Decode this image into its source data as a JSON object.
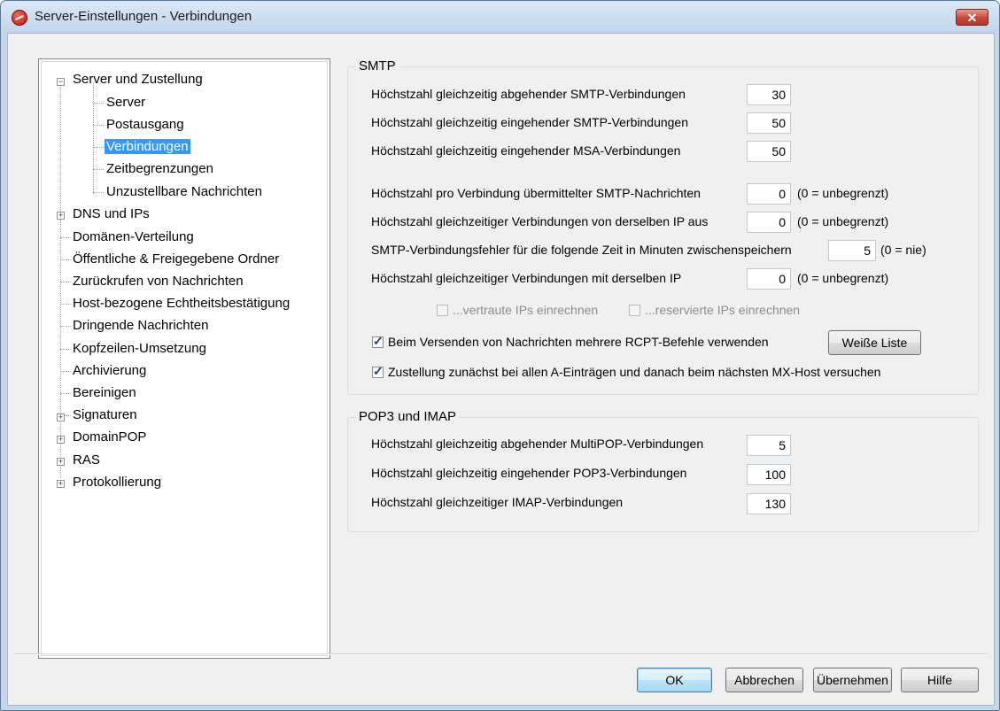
{
  "window": {
    "title": "Server-Einstellungen - Verbindungen",
    "close_glyph": "✕"
  },
  "tree": {
    "root": "Server und Zustellung",
    "children": [
      "Server",
      "Postausgang",
      "Verbindungen",
      "Zeitbegrenzungen",
      "Unzustellbare Nachrichten"
    ],
    "items": [
      "DNS und IPs",
      "Domänen-Verteilung",
      "Öffentliche & Freigegebene Ordner",
      "Zurückrufen von Nachrichten",
      "Host-bezogene Echtheitsbestätigung",
      "Dringende Nachrichten",
      "Kopfzeilen-Umsetzung",
      "Archivierung",
      "Bereinigen",
      "Signaturen",
      "DomainPOP",
      "RAS",
      "Protokollierung"
    ],
    "selected": "Verbindungen"
  },
  "smtp": {
    "group_label": "SMTP",
    "max_out_label": "Höchstzahl gleichzeitig abgehender SMTP-Verbindungen",
    "max_out_value": "30",
    "max_in_label": "Höchstzahl gleichzeitig eingehender SMTP-Verbindungen",
    "max_in_value": "50",
    "max_msa_label": "Höchstzahl gleichzeitig eingehender MSA-Verbindungen",
    "max_msa_value": "50",
    "per_conn_label": "Höchstzahl pro Verbindung übermittelter SMTP-Nachrichten",
    "per_conn_value": "0",
    "per_conn_hint": "(0 = unbegrenzt)",
    "same_ip_from_label": "Höchstzahl gleichzeitiger Verbindungen von derselben IP aus",
    "same_ip_from_value": "0",
    "same_ip_from_hint": "(0 = unbegrenzt)",
    "cache_label": "SMTP-Verbindungsfehler für die folgende Zeit in Minuten zwischenspeichern",
    "cache_value": "5",
    "cache_hint": "(0 = nie)",
    "same_ip_with_label": "Höchstzahl gleichzeitiger Verbindungen mit derselben IP",
    "same_ip_with_value": "0",
    "same_ip_with_hint": "(0 = unbegrenzt)",
    "trusted_label": "...vertraute IPs einrechnen",
    "reserved_label": "...reservierte IPs einrechnen",
    "multi_rcpt_label": "Beim Versenden von Nachrichten mehrere RCPT-Befehle verwenden",
    "whitelist_button": "Weiße Liste",
    "a_records_label": "Zustellung zunächst bei allen A-Einträgen und danach beim nächsten MX-Host versuchen"
  },
  "pop": {
    "group_label": "POP3 und IMAP",
    "multipop_label": "Höchstzahl gleichzeitig abgehender MultiPOP-Verbindungen",
    "multipop_value": "5",
    "pop3_label": "Höchstzahl gleichzeitig eingehender POP3-Verbindungen",
    "pop3_value": "100",
    "imap_label": "Höchstzahl gleichzeitiger IMAP-Verbindungen",
    "imap_value": "130"
  },
  "buttons": {
    "ok": "OK",
    "cancel": "Abbrechen",
    "apply": "Übernehmen",
    "help": "Hilfe"
  }
}
